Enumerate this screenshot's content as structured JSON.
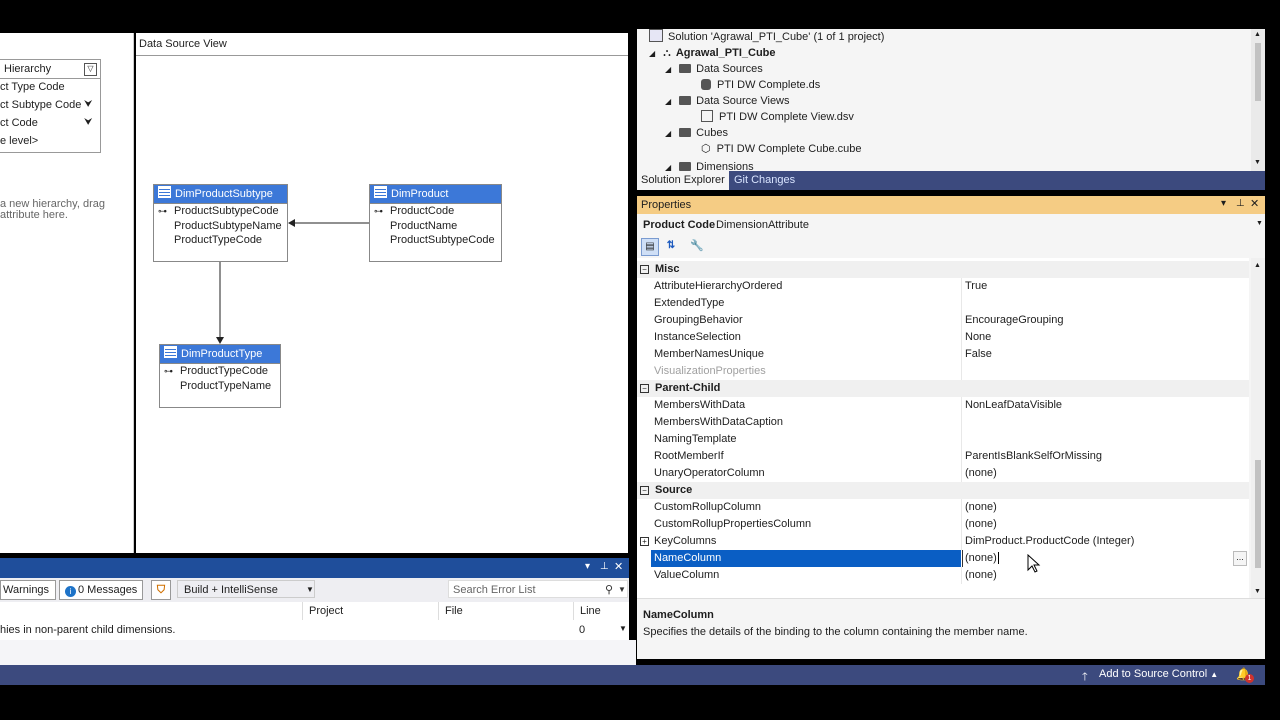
{
  "hierarchy": {
    "title": "Hierarchy",
    "levels": [
      "ct Type Code",
      "ct Subtype Code",
      "ct Code"
    ],
    "new_level": "e level>",
    "hint_line1": "a new hierarchy, drag",
    "hint_line2": "attribute here."
  },
  "dsv": {
    "title": "Data Source View",
    "tables": [
      {
        "name": "DimProductSubtype",
        "columns": [
          "ProductSubtypeCode",
          "ProductSubtypeName",
          "ProductTypeCode"
        ]
      },
      {
        "name": "DimProduct",
        "columns": [
          "ProductCode",
          "ProductName",
          "ProductSubtypeCode"
        ]
      },
      {
        "name": "DimProductType",
        "columns": [
          "ProductTypeCode",
          "ProductTypeName"
        ]
      }
    ]
  },
  "error_list": {
    "warnings": "Warnings",
    "messages": "0 Messages",
    "build_filter": "Build + IntelliSense",
    "search_placeholder": "Search Error List",
    "columns": {
      "project": "Project",
      "file": "File",
      "line": "Line"
    },
    "row": {
      "description": "hies in non-parent child dimensions.",
      "line": "0"
    }
  },
  "solution_explorer": {
    "items": [
      "Solution 'Agrawal_PTI_Cube' (1 of 1 project)",
      "Agrawal_PTI_Cube",
      "Data Sources",
      "PTI DW Complete.ds",
      "Data Source Views",
      "PTI DW Complete View.dsv",
      "Cubes",
      "PTI DW Complete Cube.cube",
      "Dimensions"
    ],
    "tabs": [
      "Solution Explorer",
      "Git Changes"
    ]
  },
  "properties": {
    "title": "Properties",
    "object_name": "Product Code",
    "object_type": "DimensionAttribute",
    "categories": [
      {
        "name": "Misc",
        "rows": [
          {
            "name": "AttributeHierarchyOrdered",
            "value": "True"
          },
          {
            "name": "ExtendedType",
            "value": ""
          },
          {
            "name": "GroupingBehavior",
            "value": "EncourageGrouping"
          },
          {
            "name": "InstanceSelection",
            "value": "None"
          },
          {
            "name": "MemberNamesUnique",
            "value": "False"
          },
          {
            "name": "VisualizationProperties",
            "value": ""
          }
        ]
      },
      {
        "name": "Parent-Child",
        "rows": [
          {
            "name": "MembersWithData",
            "value": "NonLeafDataVisible"
          },
          {
            "name": "MembersWithDataCaption",
            "value": ""
          },
          {
            "name": "NamingTemplate",
            "value": ""
          },
          {
            "name": "RootMemberIf",
            "value": "ParentIsBlankSelfOrMissing"
          },
          {
            "name": "UnaryOperatorColumn",
            "value": "(none)"
          }
        ]
      },
      {
        "name": "Source",
        "rows": [
          {
            "name": "CustomRollupColumn",
            "value": "(none)"
          },
          {
            "name": "CustomRollupPropertiesColumn",
            "value": "(none)"
          },
          {
            "name": "KeyColumns",
            "value": "DimProduct.ProductCode (Integer)"
          },
          {
            "name": "NameColumn",
            "value": "(none)"
          },
          {
            "name": "ValueColumn",
            "value": "(none)"
          }
        ]
      }
    ],
    "ellipsis": "...",
    "description_title": "NameColumn",
    "description_text": "Specifies the details of the binding to the column containing the member name."
  },
  "status_bar": {
    "source_control": "Add to Source Control",
    "notification_count": "1"
  },
  "colors": {
    "selection": "#0a5ec4",
    "accent_title": "#f5cc84",
    "statusbar": "#3c4a7e",
    "table_header": "#3c78d8"
  },
  "icons": [
    "table-icon",
    "key-icon",
    "folder-icon",
    "cube-icon",
    "database-icon",
    "wrench-icon",
    "search-icon",
    "bell-icon"
  ]
}
